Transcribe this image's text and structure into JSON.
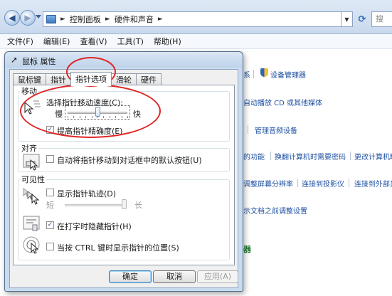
{
  "explorer": {
    "address": {
      "items": [
        "控制面板",
        "硬件和声音"
      ],
      "separator": "►"
    },
    "search_placeholder": "搜",
    "menu": [
      "文件(F)",
      "编辑(E)",
      "查看(V)",
      "工具(T)",
      "帮助(H)"
    ],
    "background_links": {
      "row1_a": "系",
      "row1_b": "设备管理器",
      "row2": "自动播放 CD 或其他媒体",
      "row3": "管理音频设备",
      "row4_a": "的功能",
      "row4_b": "换翻计算机时需要密码",
      "row4_c": "更改计算机睡",
      "row5_a": "调整屏幕分辨率",
      "row5_b": "连接到投影仪",
      "row5_c": "连接到外部显",
      "row6": "示文档之前调整设置",
      "row7": "器"
    }
  },
  "dialog": {
    "title": "鼠标 属性",
    "tabs": [
      "鼠标键",
      "指针",
      "指针选项",
      "滑轮",
      "硬件"
    ],
    "active_tab": "指针选项",
    "motion": {
      "legend": "移动",
      "speed_label": "选择指针移动速度(C):",
      "slow": "慢",
      "fast": "快",
      "speed_fraction": 0.5,
      "enhance_label": "提高指针精确度(E)",
      "enhance_checked": true
    },
    "snap": {
      "legend": "对齐",
      "label": "自动将指针移动到对话框中的默认按钮(U)",
      "checked": false
    },
    "visibility": {
      "legend": "可见性",
      "trails_label": "显示指针轨迹(D)",
      "trails_checked": false,
      "short": "短",
      "long": "长",
      "trail_fraction": 1.0,
      "hide_label": "在打字时隐藏指针(H)",
      "hide_checked": true,
      "ctrl_label": "当按 CTRL 键时显示指针的位置(S)",
      "ctrl_checked": false
    },
    "buttons": {
      "ok": "确定",
      "cancel": "取消",
      "apply": "应用(A)"
    }
  },
  "colors": {
    "annotation": "#e02424",
    "link": "#1e50a2",
    "dialog_frame": "#c9dbef"
  }
}
